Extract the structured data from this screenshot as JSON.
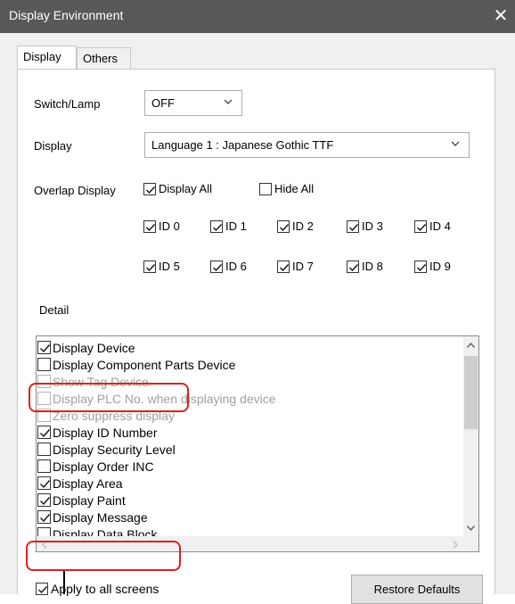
{
  "window": {
    "title": "Display Environment",
    "close_label": "✕"
  },
  "tabs": [
    {
      "label": "Display",
      "active": true
    },
    {
      "label": "Others",
      "active": false
    }
  ],
  "switch_lamp": {
    "label": "Switch/Lamp",
    "value": "OFF"
  },
  "display": {
    "label": "Display",
    "value": "Language 1 : Japanese Gothic TTF"
  },
  "overlap": {
    "label": "Overlap Display",
    "display_all": {
      "label": "Display All",
      "checked": true
    },
    "hide_all": {
      "label": "Hide All",
      "checked": false
    },
    "ids": [
      {
        "label": "ID 0",
        "checked": true
      },
      {
        "label": "ID 1",
        "checked": true
      },
      {
        "label": "ID 2",
        "checked": true
      },
      {
        "label": "ID 3",
        "checked": true
      },
      {
        "label": "ID 4",
        "checked": true
      },
      {
        "label": "ID 5",
        "checked": true
      },
      {
        "label": "ID 6",
        "checked": true
      },
      {
        "label": "ID 7",
        "checked": true
      },
      {
        "label": "ID 8",
        "checked": true
      },
      {
        "label": "ID 9",
        "checked": true
      }
    ]
  },
  "detail": {
    "label": "Detail",
    "items": [
      {
        "label": "Display Device",
        "checked": true,
        "enabled": true
      },
      {
        "label": "Display Component Parts Device",
        "checked": false,
        "enabled": true
      },
      {
        "label": "Show Tag Device.",
        "checked": false,
        "enabled": false
      },
      {
        "label": "Display PLC No. when displaying device",
        "checked": false,
        "enabled": false
      },
      {
        "label": "Zero suppress display",
        "checked": false,
        "enabled": false
      },
      {
        "label": "Display ID Number",
        "checked": true,
        "enabled": true
      },
      {
        "label": "Display Security Level",
        "checked": false,
        "enabled": true
      },
      {
        "label": "Display Order INC",
        "checked": false,
        "enabled": true
      },
      {
        "label": "Display Area",
        "checked": true,
        "enabled": true
      },
      {
        "label": "Display Paint",
        "checked": true,
        "enabled": true
      },
      {
        "label": "Display Message",
        "checked": true,
        "enabled": true
      },
      {
        "label": "Display Data Block",
        "checked": false,
        "enabled": true
      }
    ]
  },
  "apply_all": {
    "label": "Apply to all screens",
    "checked": true
  },
  "restore_defaults_label": "Restore Defaults",
  "icons": {
    "close": "close-icon",
    "dropdown": "chevron-down-icon",
    "check": "check-icon",
    "scroll_up": "scroll-up-arrow-icon",
    "scroll_down": "scroll-down-arrow-icon",
    "scroll_left": "scroll-left-arrow-icon",
    "scroll_right": "scroll-right-arrow-icon"
  },
  "colors": {
    "titlebar": "#585858",
    "highlight": "#e41e1e",
    "disabled_text": "#a0a0a0"
  }
}
